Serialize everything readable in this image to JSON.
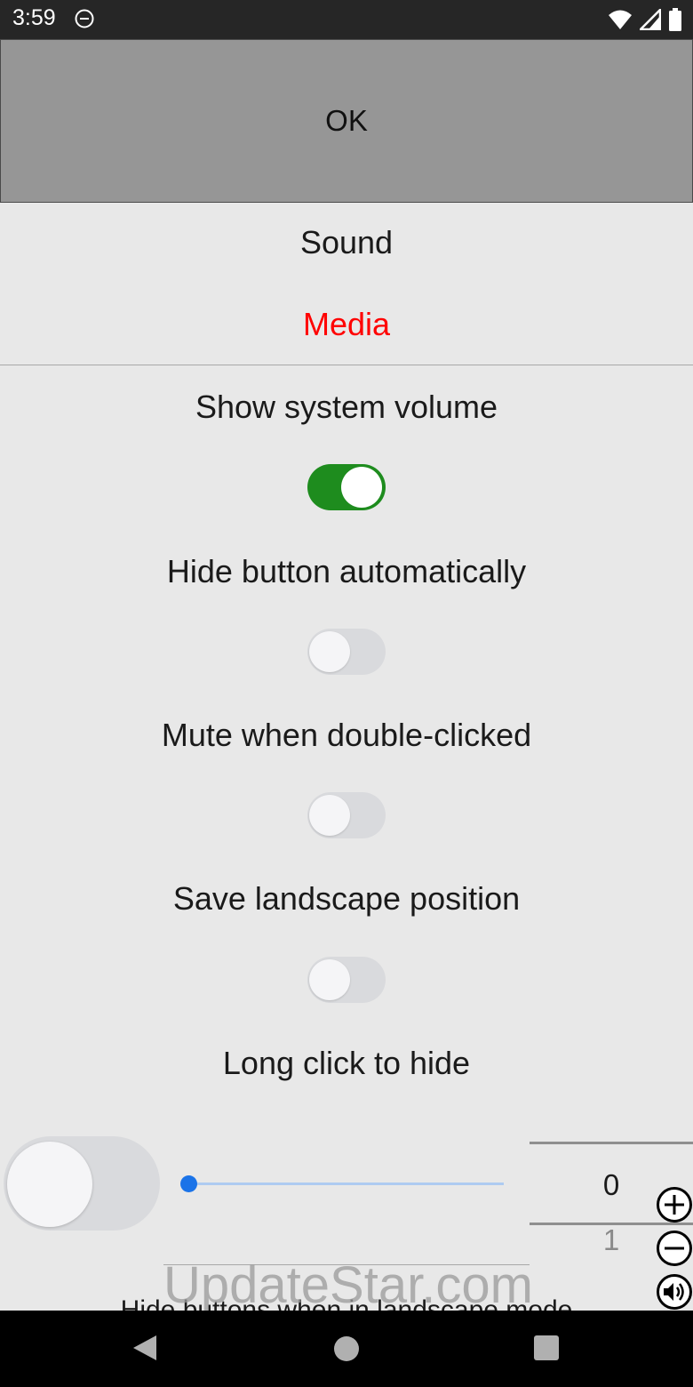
{
  "status_bar": {
    "time": "3:59"
  },
  "ok_button": {
    "label": "OK"
  },
  "tabs": [
    {
      "label": "Sound",
      "active": false
    },
    {
      "label": "Media",
      "active": true,
      "color": "#ff0000"
    }
  ],
  "settings": [
    {
      "label": "Show system volume",
      "enabled": true
    },
    {
      "label": "Hide button automatically",
      "enabled": false
    },
    {
      "label": "Mute when double-clicked",
      "enabled": false
    },
    {
      "label": "Save landscape position",
      "enabled": false
    },
    {
      "label": "Long click to hide",
      "enabled": false
    }
  ],
  "slider": {
    "value": 0
  },
  "number_picker": {
    "current": "0",
    "next": "1"
  },
  "cut_off_label": "Hide buttons when in landscape mode",
  "watermark": "UpdateStar.com",
  "colors": {
    "toggle_on": "#1e8c1e",
    "slider_accent": "#1a73e8",
    "tab_active": "#ff0000"
  }
}
